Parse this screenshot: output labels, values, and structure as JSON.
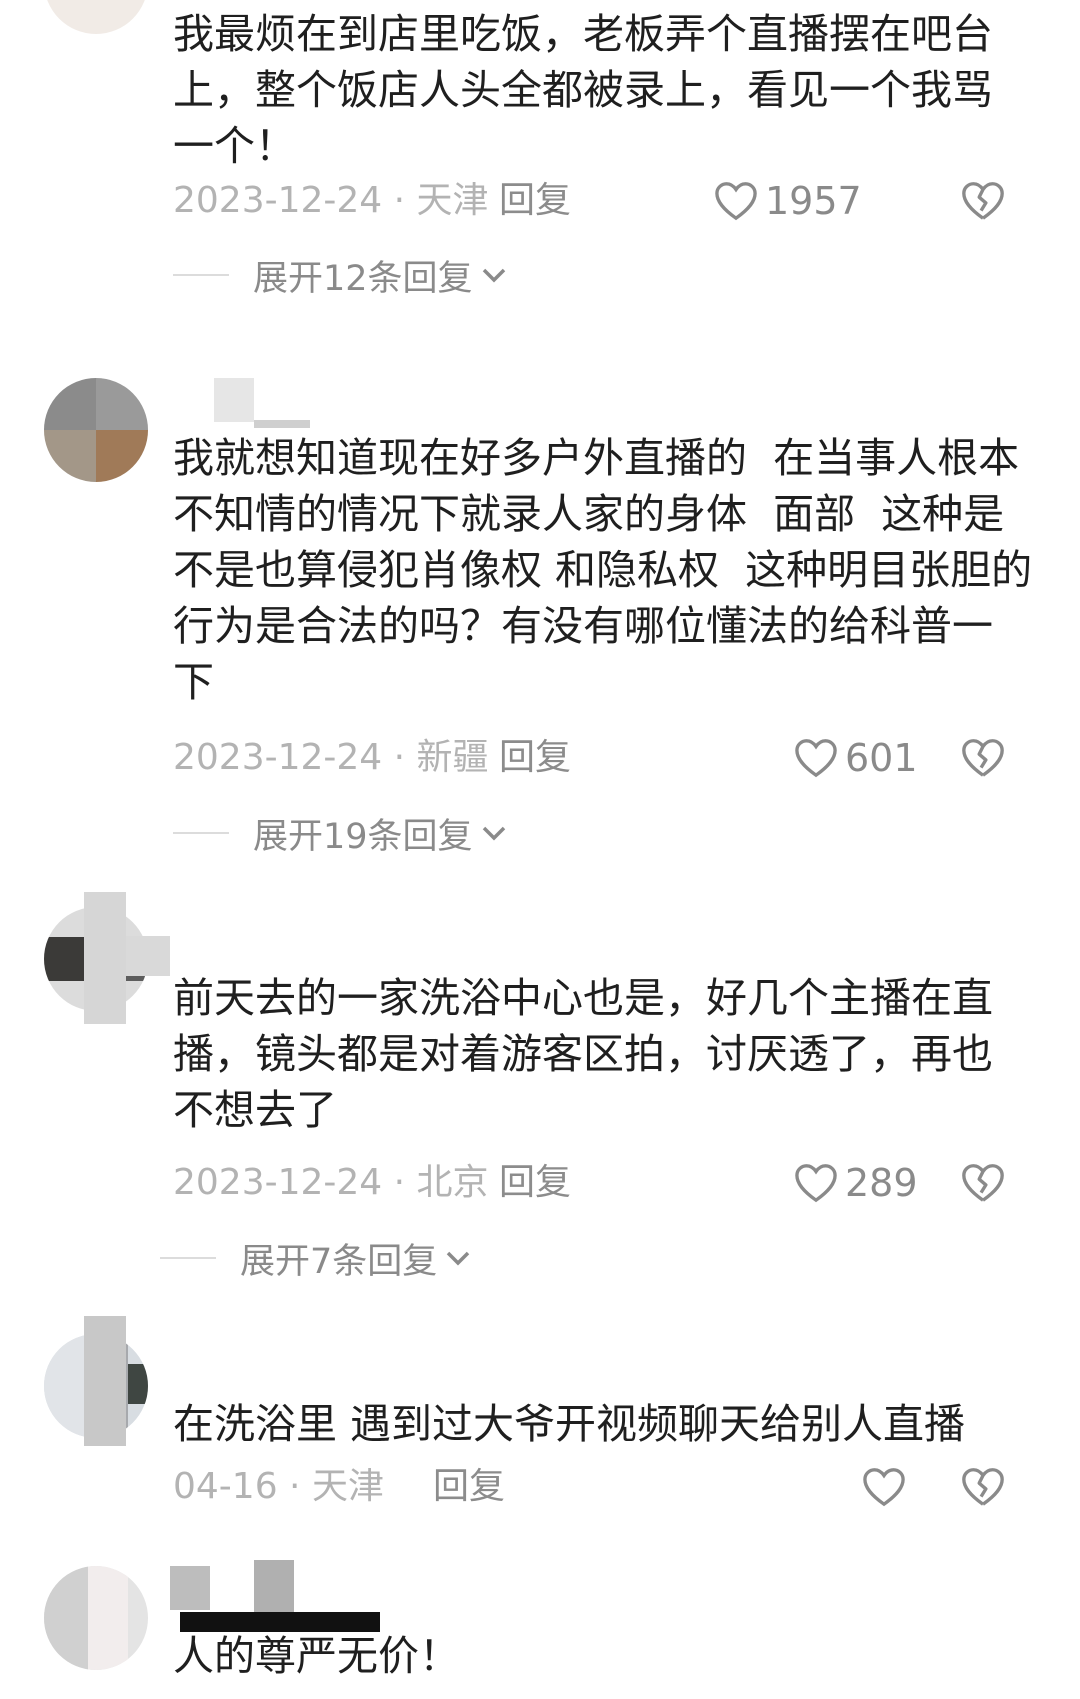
{
  "comments": [
    {
      "text": "我最烦在到店里吃饭，老板弄个直播摆在吧台上，整个饭店人头全都被录上，看见一个我骂一个！",
      "date_location": "2023-12-24 · 天津",
      "reply_label": "回复",
      "likes": "1957",
      "expand_label": "展开12条回复"
    },
    {
      "text": "我就想知道现在好多户外直播的  在当事人根本不知情的情况下就录人家的身体  面部  这种是不是也算侵犯肖像权 和隐私权  这种明目张胆的行为是合法的吗？有没有哪位懂法的给科普一下",
      "date_location": "2023-12-24 · 新疆",
      "reply_label": "回复",
      "likes": "601",
      "expand_label": "展开19条回复"
    },
    {
      "text": "前天去的一家洗浴中心也是，好几个主播在直播，镜头都是对着游客区拍，讨厌透了，再也不想去了",
      "date_location": "2023-12-24 · 北京",
      "reply_label": "回复",
      "likes": "289",
      "expand_label": "展开7条回复"
    },
    {
      "text": "在洗浴里 遇到过大爷开视频聊天给别人直播",
      "date_location": "04-16 · 天津",
      "reply_label": "回复",
      "likes": ""
    },
    {
      "text": "人的尊严无价！"
    }
  ],
  "icons": {
    "like": "heart-outline-icon",
    "dislike": "broken-heart-icon",
    "expand": "chevron-down-icon"
  },
  "colors": {
    "text": "#1f1f1f",
    "meta": "#b3b3b3",
    "reply": "#8c8c8c",
    "icon": "#8a8a8a"
  }
}
